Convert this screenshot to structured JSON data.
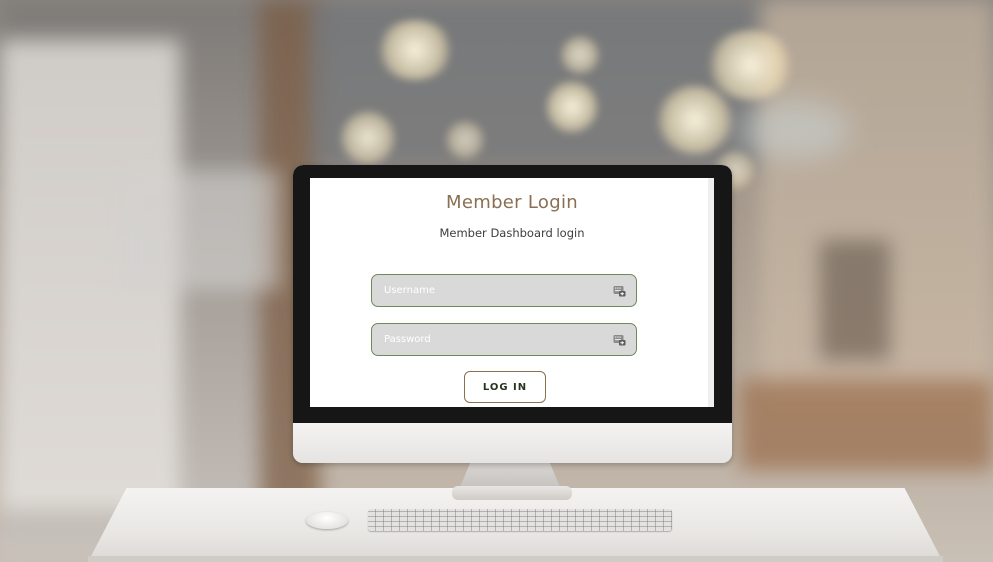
{
  "login": {
    "title": "Member Login",
    "subtitle": "Member Dashboard login",
    "username_placeholder": "Username",
    "password_placeholder": "Password",
    "button_label": "LOG IN"
  },
  "icons": {
    "username_field_icon": "key-icon",
    "password_field_icon": "key-icon"
  },
  "colors": {
    "title": "#8a6f52",
    "field_border": "#6e8a5d",
    "field_fill": "#d9d9d9",
    "button_border": "#8a6f52",
    "button_text": "#26331e"
  }
}
